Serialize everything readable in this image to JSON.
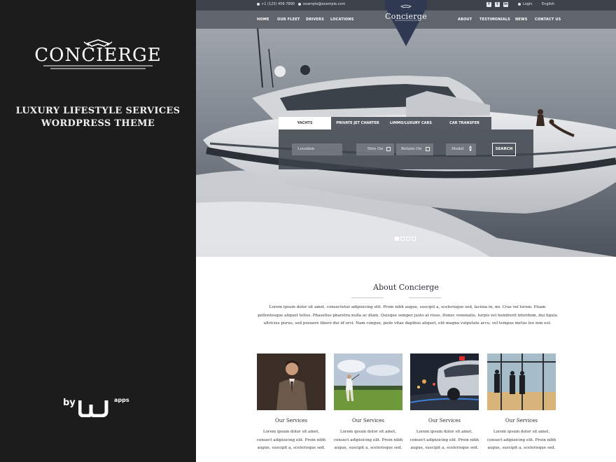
{
  "left_panel": {
    "logo_text": "CONCIERGE",
    "tagline_line1": "LUXURY LIFESTYLE SERVICES",
    "tagline_line2": "WORDPRESS THEME",
    "by_label": "by",
    "by_brand_suffix": "apps"
  },
  "topbar": {
    "phone": "+1 (123) 456-7890",
    "email": "example@example.com",
    "login": "Login",
    "language": "English"
  },
  "nav": {
    "left": [
      "HOME",
      "OUR FLEET",
      "DRIVERS",
      "LOCATIONS"
    ],
    "right": [
      "ABOUT",
      "TESTIMONIALS",
      "NEWS",
      "CONTACT US"
    ],
    "brand": "Concierge"
  },
  "search": {
    "tabs": [
      "YACHTS",
      "PRIVATE JET CHARTER",
      "LIMMO/LUXURY CARS",
      "CAR TRANSFER"
    ],
    "active_tab": 0,
    "location": "Location",
    "hire_on": "Hire On",
    "return_on": "Return On",
    "model": "Model",
    "button": "SEARCH"
  },
  "slider": {
    "count": 4,
    "active": 0
  },
  "about": {
    "title": "About Concierge",
    "text": "Lorem ipsum dolor sit amet, consectetur adipisicing elit. Proin nibh augue, suscipit a, scelerisque sed, lacinia in, mi. Cras vel lorem. Etiam pellentesque aliquet tellus. Phasellus pharetra nulla ac diam. Quisque semper justo at risus. Donec venenatis, turpis vel hendrerit interdum, dui ligula ultricies purus, sed posuere libero dui id orci. Nam congue, pede vitae dapibus aliquet, elit magna vulputate arcu, vel tempus metus leo non est."
  },
  "services": [
    {
      "title": "Our Services",
      "text": "Lorem ipsum dolor sit amet, consect adipisicing elit. Proin nibh augue, suscipit a, scelerisque sed."
    },
    {
      "title": "Our Services",
      "text": "Lorem ipsum dolor sit amet, consect adipisicing elit. Proin nibh augue, suscipit a, scelerisque sed."
    },
    {
      "title": "Our Services",
      "text": "Lorem ipsum dolor sit amet, consect adipisicing elit. Proin nibh augue, suscipit a, scelerisque sed."
    },
    {
      "title": "Our Services",
      "text": "Lorem ipsum dolor sit amet, consect adipisicing elit. Proin nibh augue, suscipit a, scelerisque sed."
    }
  ],
  "icons": {
    "topbar_phone": "phone-icon",
    "topbar_email": "envelope-icon",
    "social": [
      "facebook-icon",
      "twitter-icon",
      "linkedin-icon"
    ],
    "login": "lock-icon",
    "date_field": "calendar-icon",
    "select_field": "updown-arrows-icon"
  },
  "colors": {
    "left_panel_bg": "#1c1c1d",
    "topbar_bg": "#3d424b",
    "brand_diamond": "#2f3a52"
  }
}
